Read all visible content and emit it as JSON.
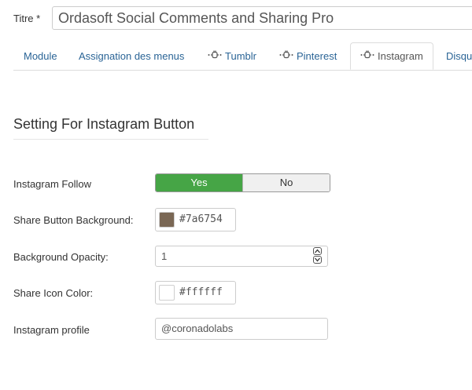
{
  "title_field": {
    "label": "Titre *",
    "value": "Ordasoft Social Comments and Sharing Pro"
  },
  "tabs": [
    {
      "label": "Module",
      "active": false,
      "icon": null
    },
    {
      "label": "Assignation des menus",
      "active": false,
      "icon": null
    },
    {
      "label": "Tumblr",
      "active": false,
      "icon": "plug-icon"
    },
    {
      "label": "Pinterest",
      "active": false,
      "icon": "plug-icon"
    },
    {
      "label": "Instagram",
      "active": true,
      "icon": "plug-icon"
    },
    {
      "label": "Disqu",
      "active": false,
      "icon": null
    }
  ],
  "section_title": "Setting For Instagram Button",
  "fields": {
    "follow": {
      "label": "Instagram Follow",
      "yes": "Yes",
      "no": "No",
      "selected": "Yes"
    },
    "share_bg": {
      "label": "Share Button Background:",
      "value": "#7a6754",
      "swatch": "#7a6754"
    },
    "opacity": {
      "label": "Background Opacity:",
      "value": "1"
    },
    "icon_color": {
      "label": "Share Icon Color:",
      "value": "#ffffff",
      "swatch": "#ffffff"
    },
    "profile": {
      "label": "Instagram profile",
      "value": "@coronadolabs"
    }
  },
  "colors": {
    "accent_green": "#46a546",
    "link_blue": "#2a6496"
  }
}
